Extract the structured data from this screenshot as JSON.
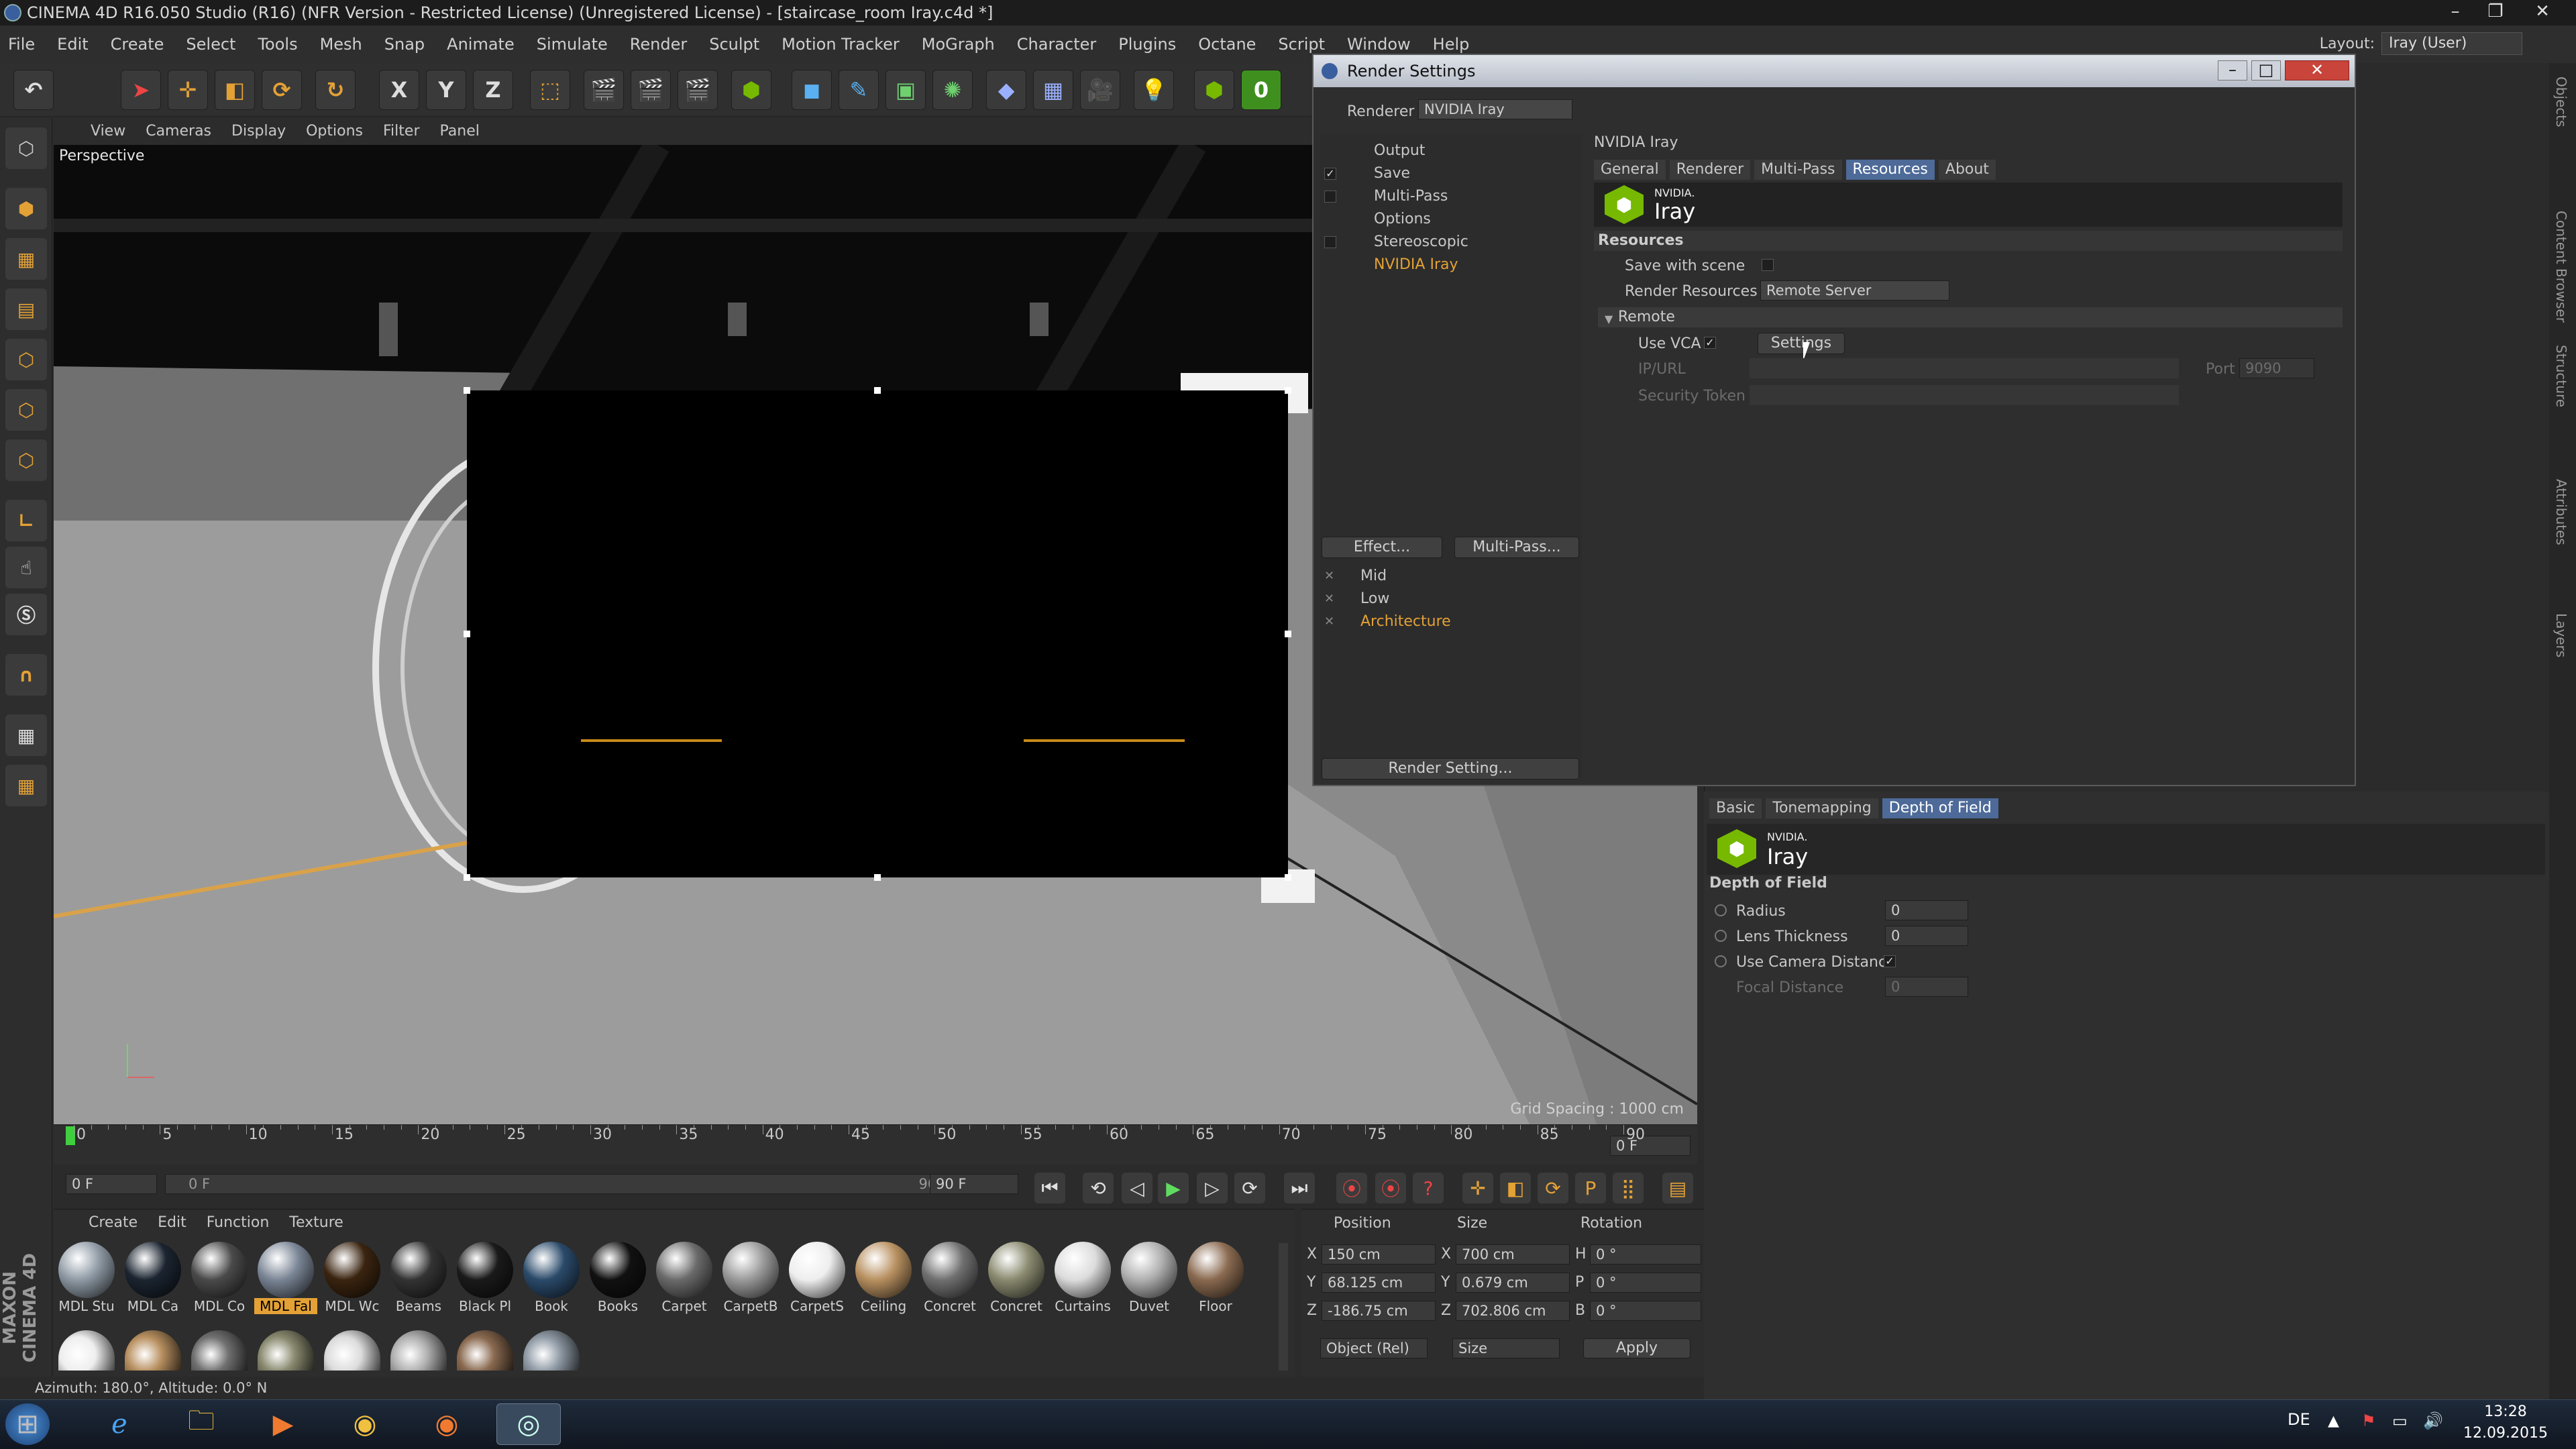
{
  "window": {
    "title": "CINEMA 4D R16.050 Studio (R16) (NFR Version - Restricted License) (Unregistered License) - [staircase_room Iray.c4d *]",
    "layout_label": "Layout:",
    "layout_value": "Iray (User)"
  },
  "menubar": [
    "File",
    "Edit",
    "Create",
    "Select",
    "Tools",
    "Mesh",
    "Snap",
    "Animate",
    "Simulate",
    "Render",
    "Sculpt",
    "Motion Tracker",
    "MoGraph",
    "Character",
    "Plugins",
    "Octane",
    "Script",
    "Window",
    "Help"
  ],
  "toolbar": {
    "axis_x": "X",
    "axis_y": "Y",
    "axis_z": "Z",
    "octane_counter": "0"
  },
  "viewport": {
    "menu": [
      "View",
      "Cameras",
      "Display",
      "Options",
      "Filter",
      "Panel"
    ],
    "title": "Perspective",
    "grid_spacing": "Grid Spacing : 1000 cm"
  },
  "timeline": {
    "ticks": [
      "0",
      "5",
      "10",
      "15",
      "20",
      "25",
      "30",
      "35",
      "40",
      "45",
      "50",
      "55",
      "60",
      "65",
      "70",
      "75",
      "80",
      "85",
      "90"
    ],
    "current_frame": "0 F",
    "start_field": "0 F",
    "range_start": "0 F",
    "range_end": "90 F",
    "end_field": "90 F"
  },
  "materials": {
    "menu": [
      "Create",
      "Edit",
      "Function",
      "Texture"
    ],
    "items": [
      {
        "label": "MDL Stu",
        "color": "#8f9aa5"
      },
      {
        "label": "MDL Ca",
        "color": "#1b2430"
      },
      {
        "label": "MDL Co",
        "color": "#4a4a4a"
      },
      {
        "label": "MDL Fal",
        "color": "#7a8595"
      },
      {
        "label": "MDL Wc",
        "color": "#3a2410"
      },
      {
        "label": "Beams",
        "color": "#333333"
      },
      {
        "label": "Black Pl",
        "color": "#1a1a1a"
      },
      {
        "label": "Book",
        "color": "#2a4a6a"
      },
      {
        "label": "Books",
        "color": "#111111"
      },
      {
        "label": "Carpet",
        "color": "#6a6a6a"
      },
      {
        "label": "CarpetB",
        "color": "#9a9a9a"
      },
      {
        "label": "CarpetS",
        "color": "#eeeeee"
      },
      {
        "label": "Ceiling",
        "color": "#b89060"
      },
      {
        "label": "Concret",
        "color": "#707070"
      },
      {
        "label": "Concret",
        "color": "#8a8a70"
      },
      {
        "label": "Curtains",
        "color": "#dcdcdc"
      },
      {
        "label": "Duvet",
        "color": "#b0b0b0"
      },
      {
        "label": "Floor",
        "color": "#8a6a50"
      }
    ],
    "selected_index": 3
  },
  "coords": {
    "headers": [
      "Position",
      "Size",
      "Rotation"
    ],
    "rows": [
      {
        "axis": "X",
        "position": "150 cm",
        "saxis": "X",
        "size": "700 cm",
        "raxis": "H",
        "rotation": "0 °"
      },
      {
        "axis": "Y",
        "position": "68.125 cm",
        "saxis": "Y",
        "size": "0.679 cm",
        "raxis": "P",
        "rotation": "0 °"
      },
      {
        "axis": "Z",
        "position": "-186.75 cm",
        "saxis": "Z",
        "size": "702.806 cm",
        "raxis": "B",
        "rotation": "0 °"
      }
    ],
    "mode_select": "Object (Rel)",
    "size_select": "Size",
    "apply_label": "Apply"
  },
  "status": "Azimuth: 180.0°, Altitude: 0.0°  N",
  "maxon": "MAXON CINEMA 4D",
  "render_settings": {
    "title": "Render Settings",
    "renderer_label": "Renderer",
    "renderer_value": "NVIDIA Iray",
    "tree": [
      {
        "label": "Output",
        "checked": false,
        "check": false
      },
      {
        "label": "Save",
        "checked": true,
        "check": true
      },
      {
        "label": "Multi-Pass",
        "checked": false,
        "check": true
      },
      {
        "label": "Options",
        "checked": false,
        "check": false
      },
      {
        "label": "Stereoscopic",
        "checked": false,
        "check": true
      },
      {
        "label": "NVIDIA Iray",
        "checked": false,
        "check": false,
        "active": true
      }
    ],
    "effect_button": "Effect...",
    "multipass_button": "Multi-Pass...",
    "presets": [
      "Mid",
      "Low",
      "Architecture"
    ],
    "render_setting_button": "Render Setting...",
    "panel_title": "NVIDIA Iray",
    "tabs": [
      "General",
      "Renderer",
      "Multi-Pass",
      "Resources",
      "About"
    ],
    "active_tab": "Resources",
    "logo_top": "NVIDIA.",
    "logo_bottom": "Iray",
    "section": "Resources",
    "save_with_scene": "Save with scene",
    "render_resources_label": "Render Resources",
    "render_resources_value": "Remote Server",
    "remote_group": "Remote",
    "use_vca": "Use VCA",
    "settings_button": "Settings",
    "ip_label": "IP/URL",
    "port_label": "Port",
    "port_value": "9090",
    "token_label": "Security Token"
  },
  "attributes": {
    "tabs": [
      "Basic",
      "Tonemapping",
      "Depth of Field"
    ],
    "active_tab": "Depth of Field",
    "logo_top": "NVIDIA.",
    "logo_bottom": "Iray",
    "section": "Depth of Field",
    "radius_label": "Radius",
    "radius_value": "0",
    "lens_label": "Lens Thickness",
    "lens_value": "0",
    "ucd_label": "Use Camera Distance",
    "focal_label": "Focal Distance",
    "focal_value": "0"
  },
  "right_strip_tabs": [
    "Objects",
    "Content Browser",
    "Structure",
    "Attributes",
    "Layers"
  ],
  "taskbar": {
    "lang": "DE",
    "time": "13:28",
    "date": "12.09.2015"
  }
}
